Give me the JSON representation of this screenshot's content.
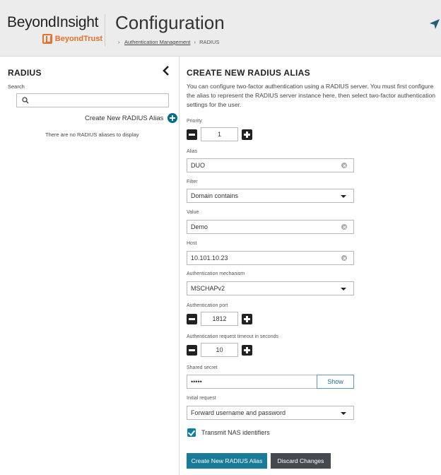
{
  "header": {
    "brand": "BeyondInsight",
    "sub_brand": "BeyondTrust",
    "title": "Configuration",
    "breadcrumb": [
      {
        "label": "Authentication Management"
      },
      {
        "label": "RADIUS"
      }
    ]
  },
  "sidebar": {
    "title": "RADIUS",
    "search_label": "Search",
    "search_value": "",
    "create_link": "Create New RADIUS Alias",
    "empty_message": "There are no RADIUS aliases to display"
  },
  "form": {
    "title": "CREATE NEW RADIUS ALIAS",
    "description": "You can configure two-factor authentication using a RADIUS server. You must first configure the alias to represent the RADIUS server instance here, then select two-factor authentication settings for the user.",
    "priority": {
      "label": "Priority",
      "value": "1"
    },
    "alias": {
      "label": "Alias",
      "value": "DUO"
    },
    "filter": {
      "label": "Filter",
      "value": "Domain contains"
    },
    "value": {
      "label": "Value",
      "value": "Demo"
    },
    "host": {
      "label": "Host",
      "value": "10.101.10.23"
    },
    "auth_mechanism": {
      "label": "Authentication mechanism",
      "value": "MSCHAPv2"
    },
    "auth_port": {
      "label": "Authentication port",
      "value": "1812"
    },
    "timeout": {
      "label": "Authentication request timeout in seconds",
      "value": "10"
    },
    "shared_secret": {
      "label": "Shared secret",
      "value": "•••••",
      "show_label": "Show"
    },
    "initial_request": {
      "label": "Initial request",
      "value": "Forward username and password"
    },
    "transmit_nas": {
      "label": "Transmit NAS identifiers",
      "checked": true
    },
    "create_button": "Create New RADIUS Alias",
    "discard_button": "Discard Changes"
  },
  "colors": {
    "accent": "#1a7a99",
    "brand_orange": "#e8702a",
    "secondary_button": "#454a50"
  }
}
